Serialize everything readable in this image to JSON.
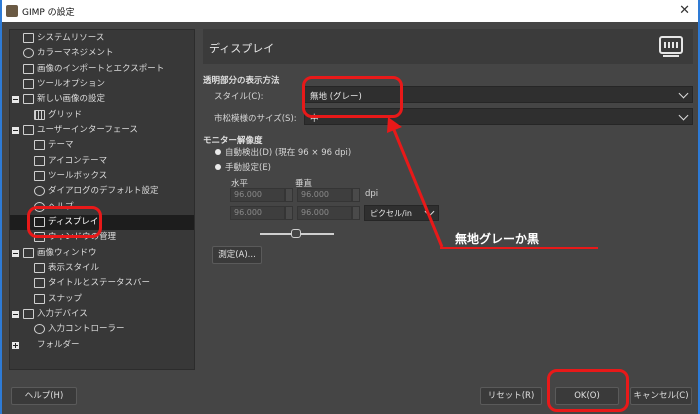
{
  "window": {
    "title": "GIMP の設定",
    "close_glyph": "✕"
  },
  "tree": {
    "items": [
      {
        "label": "システムリソース",
        "icon": "chip-icon"
      },
      {
        "label": "カラーマネジメント",
        "icon": "color-icon"
      },
      {
        "label": "画像のインポートとエクスポート",
        "icon": "image-io-icon"
      },
      {
        "label": "ツールオプション",
        "icon": "tool-options-icon"
      },
      {
        "label": "新しい画像の設定",
        "icon": "new-image-icon"
      },
      {
        "label": "グリッド",
        "icon": "grid-icon"
      },
      {
        "label": "ユーザーインターフェース",
        "icon": "interface-icon"
      },
      {
        "label": "テーマ",
        "icon": "theme-icon"
      },
      {
        "label": "アイコンテーマ",
        "icon": "icon-theme-icon"
      },
      {
        "label": "ツールボックス",
        "icon": "toolbox-icon"
      },
      {
        "label": "ダイアログのデフォルト設定",
        "icon": "dialog-defaults-icon"
      },
      {
        "label": "ヘルプ",
        "icon": "help-icon"
      },
      {
        "label": "ディスプレイ",
        "icon": "display-icon"
      },
      {
        "label": "ウィンドウの管理",
        "icon": "window-management-icon"
      },
      {
        "label": "画像ウィンドウ",
        "icon": "image-window-icon"
      },
      {
        "label": "表示スタイル",
        "icon": "appearance-icon"
      },
      {
        "label": "タイトルとステータスバー",
        "icon": "title-status-icon"
      },
      {
        "label": "スナップ",
        "icon": "snap-icon"
      },
      {
        "label": "入力デバイス",
        "icon": "input-device-icon"
      },
      {
        "label": "入力コントローラー",
        "icon": "input-controller-icon"
      },
      {
        "label": "フォルダー",
        "icon": "folder-icon"
      }
    ],
    "selected": "ディスプレイ"
  },
  "panel": {
    "title": "ディスプレイ",
    "transparency": {
      "heading": "透明部分の表示方法",
      "style_label": "スタイル(C):",
      "style_value": "無地 (グレー)",
      "check_size_label": "市松模様のサイズ(S):",
      "check_size_value": "中"
    },
    "monitor": {
      "heading": "モニター解像度",
      "auto_label": "自動検出(D) (現在 96 × 96 dpi)",
      "manual_label": "手動設定(E)",
      "horizontal": "水平",
      "vertical": "垂直",
      "dpi": "dpi",
      "h_value": "96.000",
      "v_value": "96.000",
      "h_value2": "96.000",
      "v_value2": "96.000",
      "unit": "ピクセル/in",
      "calibrate_button": "測定(A)..."
    }
  },
  "buttons": {
    "help": "ヘルプ(H)",
    "reset": "リセット(R)",
    "ok": "OK(O)",
    "cancel": "キャンセル(C)"
  },
  "annotation": {
    "text": "無地グレーか黒"
  }
}
